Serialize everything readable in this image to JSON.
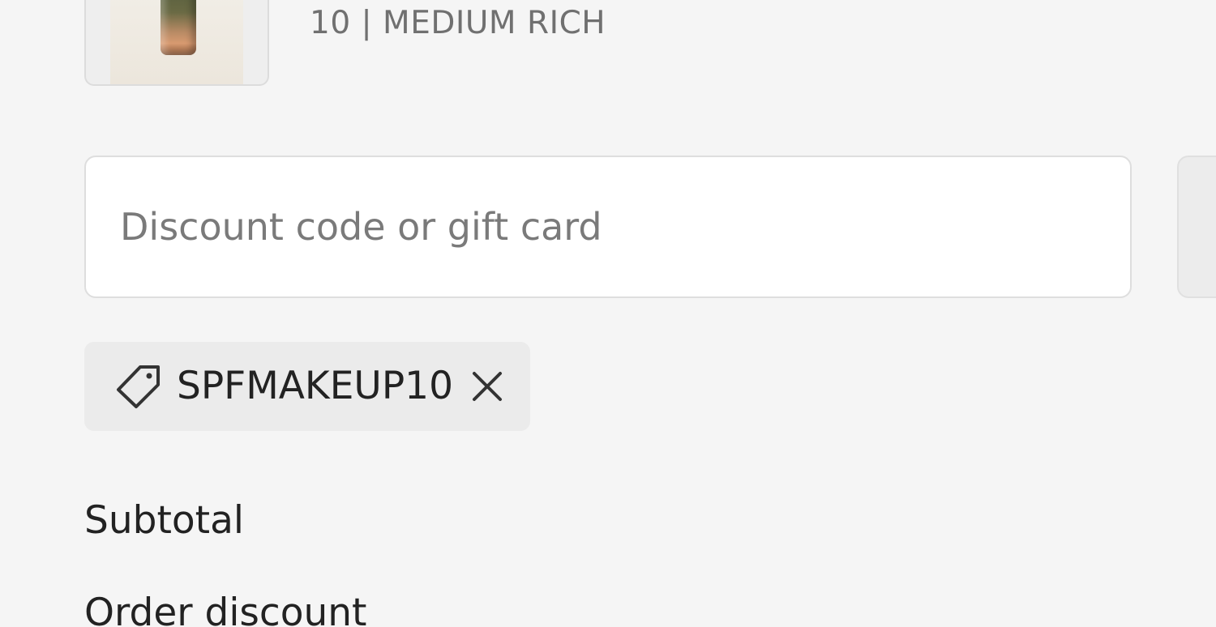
{
  "product": {
    "variant": "10 | MEDIUM RICH"
  },
  "discount": {
    "placeholder": "Discount code or gift card",
    "value": "",
    "applied_code": "SPFMAKEUP10",
    "tag_icon": "tag-icon",
    "remove_icon": "close-icon"
  },
  "summary": {
    "subtotal_label": "Subtotal",
    "order_discount_label": "Order discount"
  },
  "colors": {
    "background": "#f5f5f5",
    "tag_background": "#ebebeb",
    "muted_text": "#707070"
  }
}
